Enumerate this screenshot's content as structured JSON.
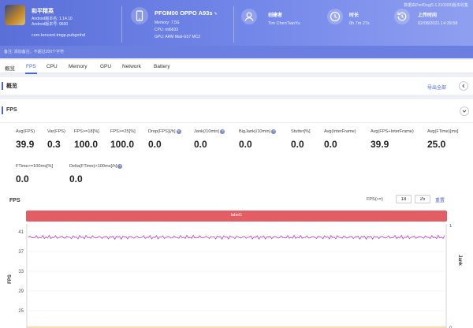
{
  "header": {
    "note": "数据由PerfDog(5.1.210300)版本收集",
    "app": {
      "name": "和平精英",
      "android_version": "Android版本名: 1.14.10",
      "android_code": "Android版本号: 9600",
      "package": "com.tencent.tmgp.pubgmhd"
    },
    "device": {
      "name": "PFGM00 OPPO A93s",
      "memory": "Memory: 7.5G",
      "cpu": "CPU: mt6833",
      "gpu": "GPU: ARM Mali-G57 MC2"
    },
    "creator": {
      "label": "创建者",
      "value": "Tim ChenTianYu"
    },
    "duration": {
      "label": "时长",
      "value": "0h 7m 27s"
    },
    "upload": {
      "label": "上传时间",
      "value": "02/08/2021 14:39:58"
    },
    "remark": "备注: 添加备注，不超过200个字符"
  },
  "tabs": [
    "概览",
    "FPS",
    "CPU",
    "Memory",
    "GPU",
    "Network",
    "Battery"
  ],
  "active_tab": "FPS",
  "overview": {
    "title": "概览",
    "export": "导出全部"
  },
  "fps": {
    "title": "FPS",
    "metrics": [
      {
        "label": "Avg(FPS)",
        "value": "39.9",
        "help": false
      },
      {
        "label": "Var(FPS)",
        "value": "0.3",
        "help": false
      },
      {
        "label": "FPS>=18[%]",
        "value": "100.0",
        "help": false
      },
      {
        "label": "FPS>=25[%]",
        "value": "100.0",
        "help": false
      },
      {
        "label": "Drop(FPS)[/h]",
        "value": "0.0",
        "help": true
      },
      {
        "label": "Jank(/10min)",
        "value": "0.0",
        "help": true
      },
      {
        "label": "BigJank(/10min)",
        "value": "0.0",
        "help": true
      },
      {
        "label": "Stutter[%]",
        "value": "0.0",
        "help": false
      },
      {
        "label": "Avg(InterFrame)",
        "value": "0.0",
        "help": false
      },
      {
        "label": "Avg(FPS+InterFrame)",
        "value": "39.9",
        "help": false
      },
      {
        "label": "Avg(FTime)[ms]",
        "value": "25.0",
        "help": false
      },
      {
        "label": "FTime>=100ms[%]",
        "value": "0.0",
        "help": false
      },
      {
        "label": "Delta(FTime)>100ms[/h]",
        "value": "0.0",
        "help": true
      }
    ],
    "chart_title": "FPS",
    "range_label": "FPS(>=)",
    "range_min": "18",
    "range_max": "25",
    "reset": "重置",
    "label_band": "label1"
  },
  "chart_data": {
    "type": "line",
    "title": "FPS",
    "ylabel": "FPS",
    "y2label": "Jank",
    "yticks_left": [
      "41",
      "37",
      "33",
      "29",
      "25",
      "21"
    ],
    "yticks_right": [
      "1",
      "0"
    ],
    "ylim": [
      21,
      41
    ],
    "y2lim": [
      0,
      1
    ],
    "series": [
      {
        "name": "FPS",
        "color": "#c050c8",
        "mean": 39.9,
        "min": 39.5,
        "max": 40.3
      },
      {
        "name": "Jank",
        "color": "#f0a040",
        "values_constant": 0
      }
    ]
  }
}
